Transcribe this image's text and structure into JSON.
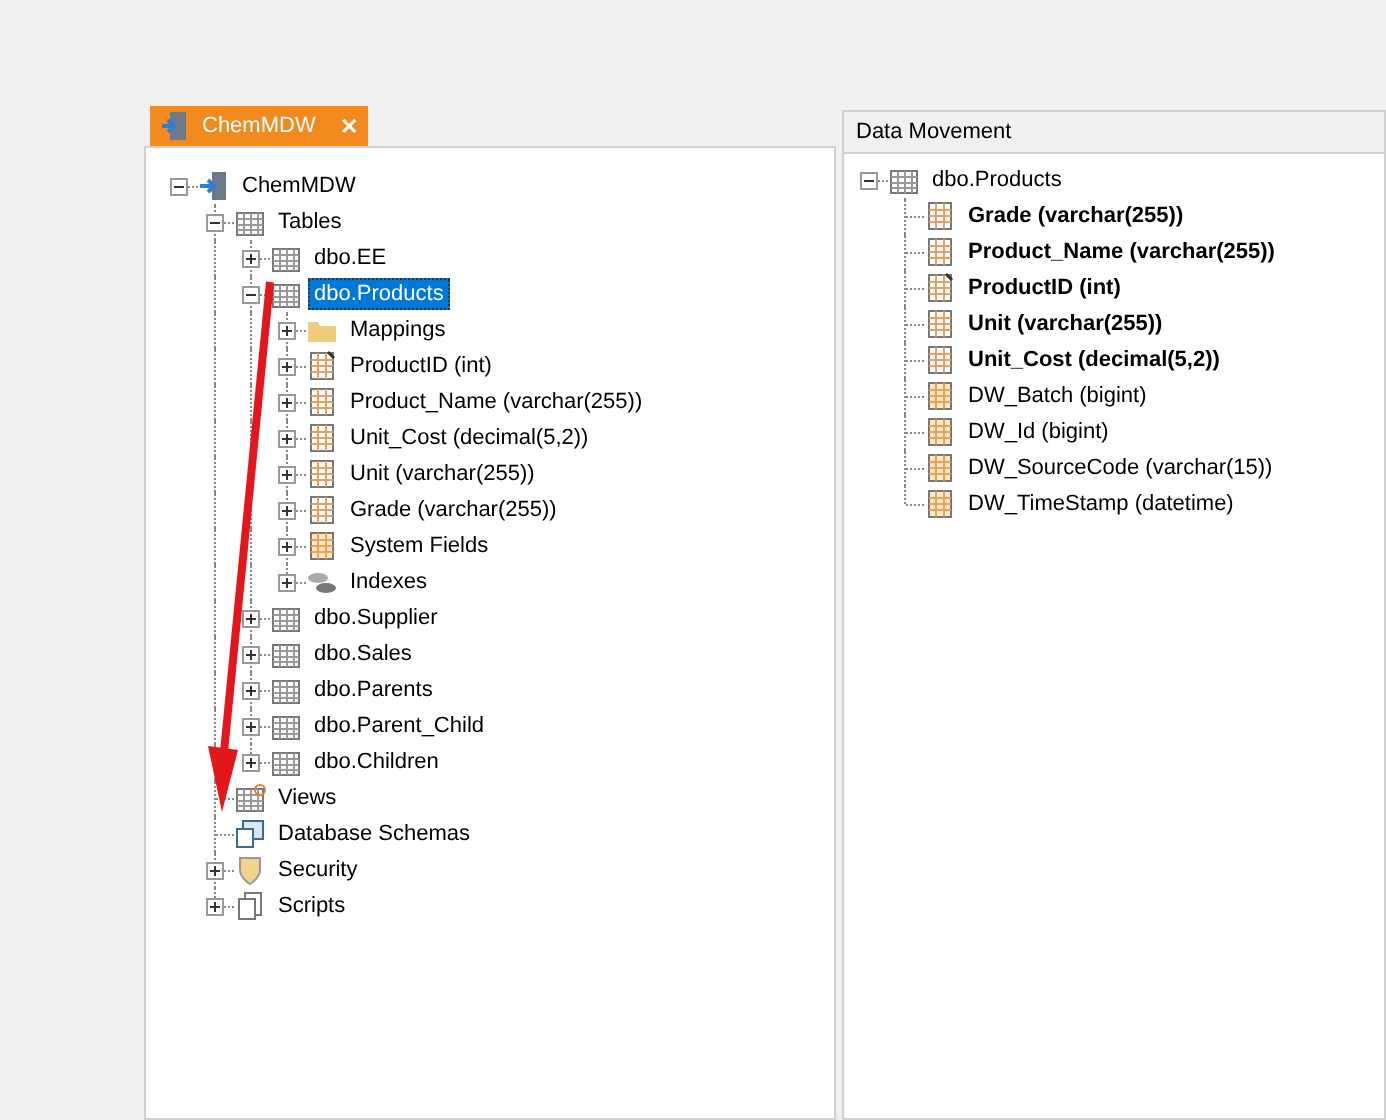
{
  "tab": {
    "label": "ChemMDW",
    "close": "✕",
    "selected": true
  },
  "explorer": {
    "tree": [
      {
        "label": "ChemMDW",
        "kind": "database",
        "expanded": true,
        "selected": false,
        "children": [
          {
            "label": "Tables",
            "kind": "tables",
            "expanded": true,
            "selected": false,
            "children": [
              {
                "label": "dbo.EE",
                "kind": "table",
                "expanded": false,
                "selected": false
              },
              {
                "label": "dbo.Products",
                "kind": "table",
                "expanded": true,
                "selected": true,
                "children": [
                  {
                    "label": "Mappings",
                    "kind": "folder",
                    "expanded": false,
                    "selected": false
                  },
                  {
                    "label": "ProductID (int)",
                    "kind": "key-column",
                    "expanded": false,
                    "selected": false
                  },
                  {
                    "label": "Product_Name (varchar(255))",
                    "kind": "column",
                    "expanded": false,
                    "selected": false
                  },
                  {
                    "label": "Unit_Cost (decimal(5,2))",
                    "kind": "column",
                    "expanded": false,
                    "selected": false
                  },
                  {
                    "label": "Unit (varchar(255))",
                    "kind": "column",
                    "expanded": false,
                    "selected": false
                  },
                  {
                    "label": "Grade (varchar(255))",
                    "kind": "column",
                    "expanded": false,
                    "selected": false
                  },
                  {
                    "label": "System Fields",
                    "kind": "system-column",
                    "expanded": false,
                    "selected": false
                  },
                  {
                    "label": "Indexes",
                    "kind": "indexes",
                    "expanded": false,
                    "selected": false
                  }
                ]
              },
              {
                "label": "dbo.Supplier",
                "kind": "table",
                "expanded": false,
                "selected": false
              },
              {
                "label": "dbo.Sales",
                "kind": "table",
                "expanded": false,
                "selected": false
              },
              {
                "label": "dbo.Parents",
                "kind": "table",
                "expanded": false,
                "selected": false
              },
              {
                "label": "dbo.Parent_Child",
                "kind": "table",
                "expanded": false,
                "selected": false
              },
              {
                "label": "dbo.Children",
                "kind": "table",
                "expanded": false,
                "selected": false
              }
            ]
          },
          {
            "label": "Views",
            "kind": "views",
            "selected": false
          },
          {
            "label": "Database Schemas",
            "kind": "schemas",
            "selected": false
          },
          {
            "label": "Security",
            "kind": "security",
            "expanded": false,
            "selected": false
          },
          {
            "label": "Scripts",
            "kind": "scripts",
            "expanded": false,
            "selected": false
          }
        ]
      }
    ]
  },
  "data_movement": {
    "title": "Data Movement",
    "tree": [
      {
        "label": "dbo.Products",
        "kind": "table",
        "expanded": true,
        "selected": false,
        "children": [
          {
            "label": "Grade (varchar(255))",
            "kind": "column",
            "bold": true,
            "selected": false
          },
          {
            "label": "Product_Name (varchar(255))",
            "kind": "column",
            "bold": true,
            "selected": false
          },
          {
            "label": "ProductID (int)",
            "kind": "key-column",
            "bold": true,
            "selected": false
          },
          {
            "label": "Unit (varchar(255))",
            "kind": "column",
            "bold": true,
            "selected": false
          },
          {
            "label": "Unit_Cost (decimal(5,2))",
            "kind": "column",
            "bold": true,
            "selected": false
          },
          {
            "label": "DW_Batch (bigint)",
            "kind": "system-column",
            "bold": false,
            "selected": false
          },
          {
            "label": "DW_Id (bigint)",
            "kind": "system-column",
            "bold": false,
            "selected": false
          },
          {
            "label": "DW_SourceCode (varchar(15))",
            "kind": "system-column",
            "bold": false,
            "selected": false
          },
          {
            "label": "DW_TimeStamp (datetime)",
            "kind": "system-column",
            "bold": false,
            "selected": false
          }
        ]
      }
    ]
  }
}
